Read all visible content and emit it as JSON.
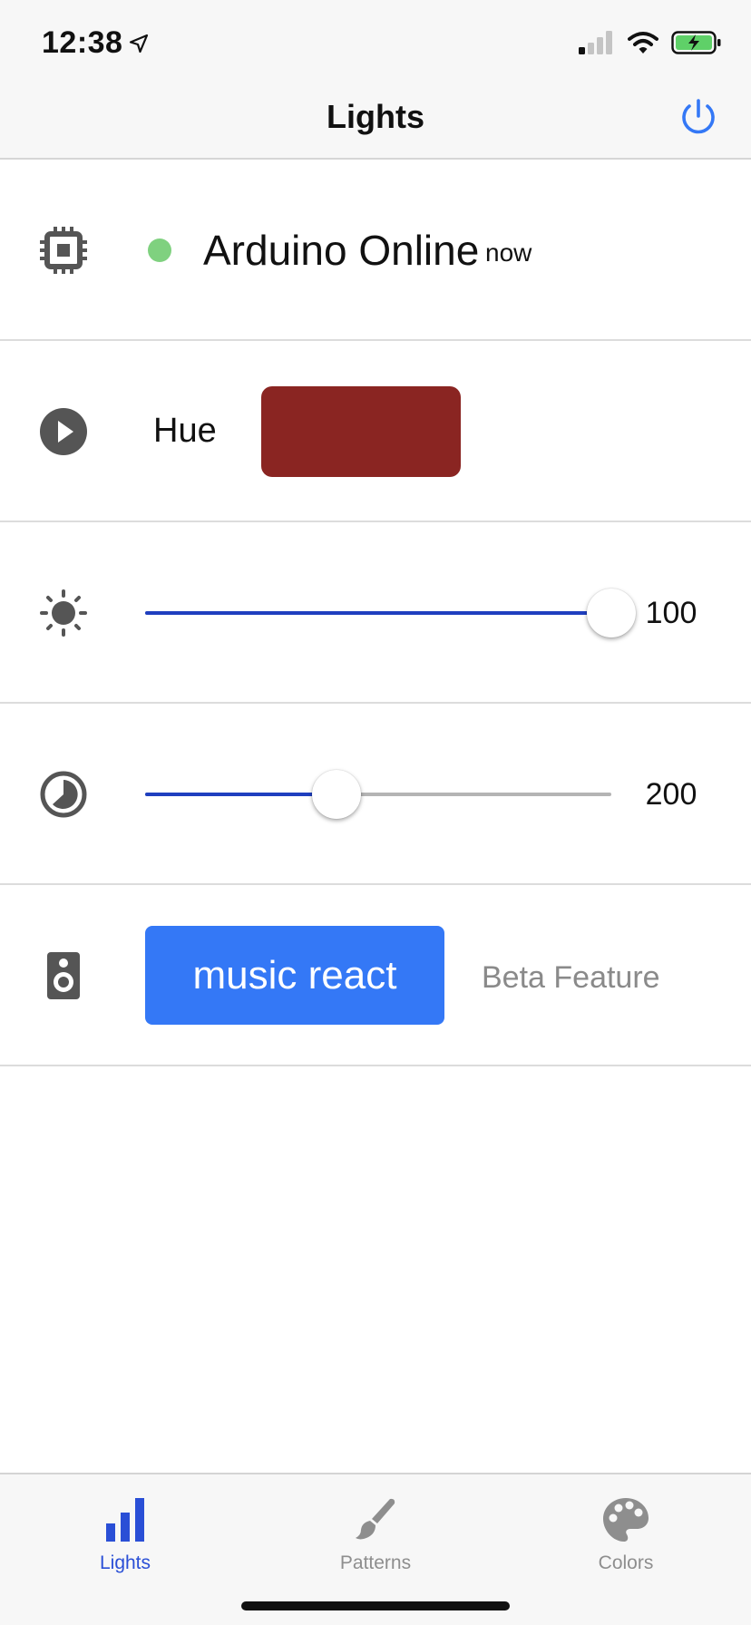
{
  "status_bar": {
    "time": "12:38"
  },
  "header": {
    "title": "Lights"
  },
  "device": {
    "name": "Arduino Online",
    "last_seen": "now",
    "status_color": "#7fd17f"
  },
  "hue": {
    "label": "Hue",
    "color": "#8a2522"
  },
  "brightness": {
    "value_label": "100",
    "fraction": 1.0
  },
  "speed": {
    "value_label": "200",
    "fraction": 0.41
  },
  "music": {
    "button_label": "music react",
    "note": "Beta Feature"
  },
  "tabs": [
    {
      "label": "Lights",
      "active": true
    },
    {
      "label": "Patterns",
      "active": false
    },
    {
      "label": "Colors",
      "active": false
    }
  ],
  "colors": {
    "accent_blue": "#3478f6",
    "slider_blue": "#1f3fbf",
    "tab_active": "#2a4fd6",
    "tab_inactive": "#8e8e8e",
    "icon_gray": "#555555"
  }
}
